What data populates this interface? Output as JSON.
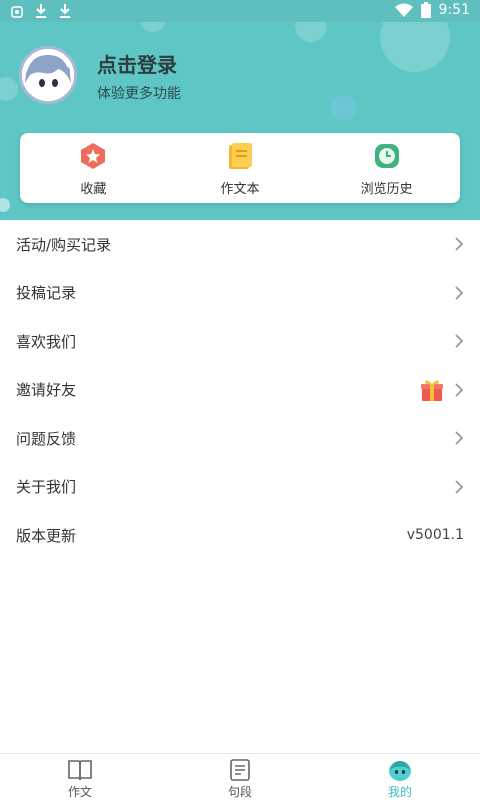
{
  "status_bar": {
    "time": "9:51"
  },
  "header": {
    "title": "点击登录",
    "subtitle": "体验更多功能"
  },
  "quick_actions": [
    {
      "label": "收藏",
      "icon": "star-badge-icon"
    },
    {
      "label": "作文本",
      "icon": "notebook-icon"
    },
    {
      "label": "浏览历史",
      "icon": "clock-icon"
    }
  ],
  "menu": [
    {
      "label": "活动/购买记录"
    },
    {
      "label": "投稿记录"
    },
    {
      "label": "喜欢我们"
    },
    {
      "label": "邀请好友",
      "badge_icon": "gift-icon"
    },
    {
      "label": "问题反馈"
    },
    {
      "label": "关于我们"
    },
    {
      "label": "版本更新",
      "value": "v5001.1"
    }
  ],
  "tabs": [
    {
      "label": "作文",
      "icon": "book-icon"
    },
    {
      "label": "句段",
      "icon": "document-icon"
    },
    {
      "label": "我的",
      "icon": "mascot-icon",
      "active": true
    }
  ],
  "colors": {
    "header_bg": "#5ec7c6",
    "accent": "#3bbfbf"
  }
}
